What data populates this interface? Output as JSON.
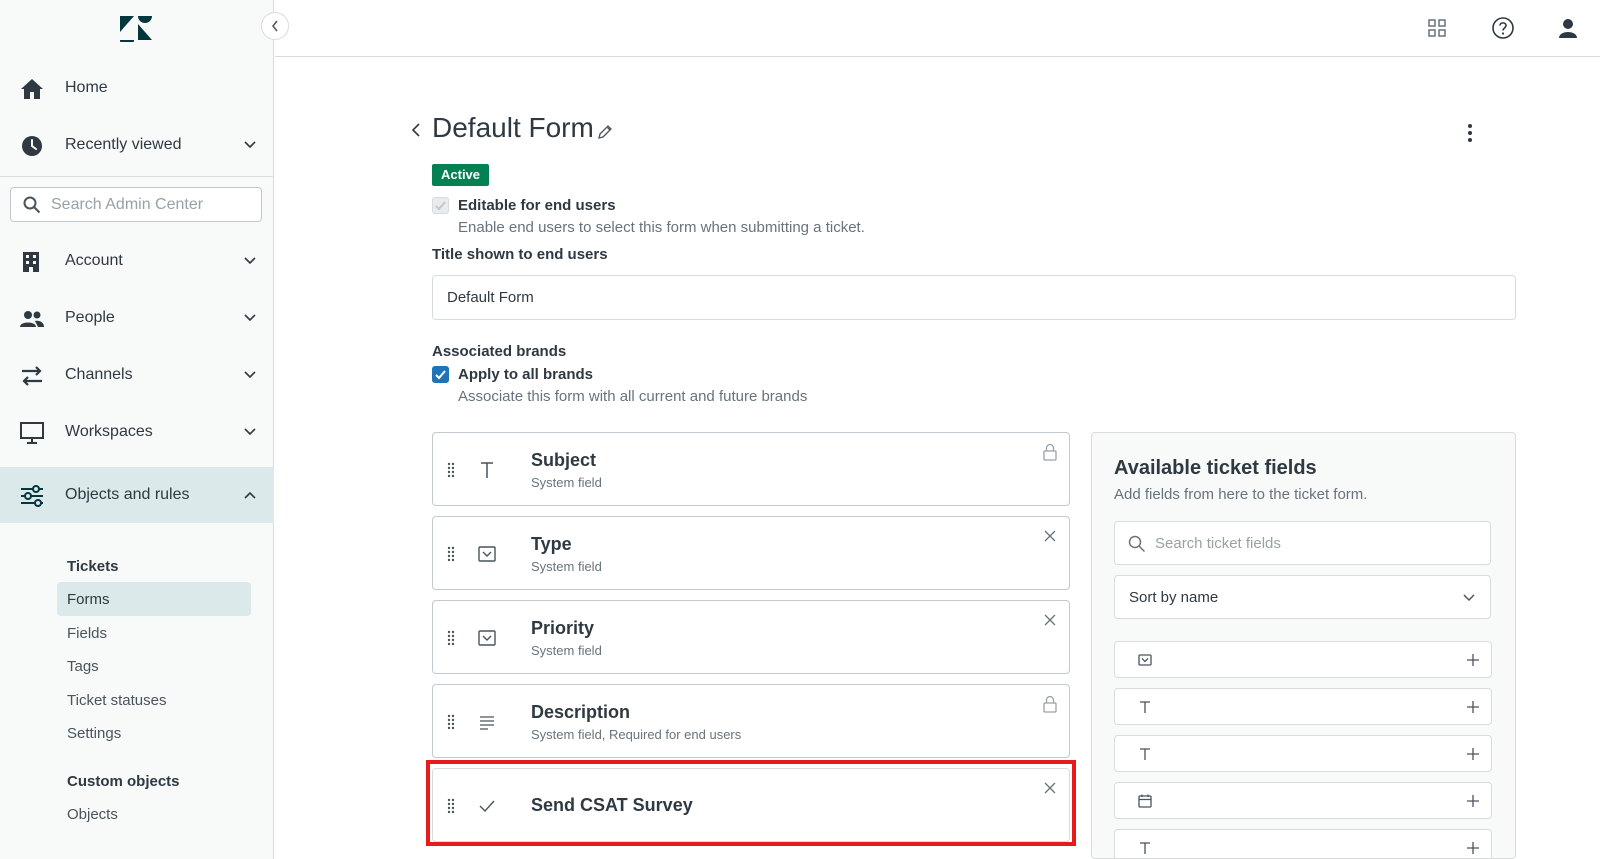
{
  "sidebar": {
    "nav": [
      {
        "label": "Home",
        "icon": "home-icon"
      },
      {
        "label": "Recently viewed",
        "icon": "clock-icon"
      },
      {
        "label": "Account",
        "icon": "building-icon"
      },
      {
        "label": "People",
        "icon": "people-icon"
      },
      {
        "label": "Channels",
        "icon": "channels-icon"
      },
      {
        "label": "Workspaces",
        "icon": "monitor-icon"
      },
      {
        "label": "Objects and rules",
        "icon": "objects-rules-icon"
      }
    ],
    "search_placeholder": "Search Admin Center",
    "tickets_heading": "Tickets",
    "ticket_items": [
      "Forms",
      "Fields",
      "Tags",
      "Ticket statuses",
      "Settings"
    ],
    "custom_objects_heading": "Custom objects",
    "custom_object_items": [
      "Objects"
    ]
  },
  "form": {
    "title": "Default Form",
    "status_badge": "Active",
    "editable_label": "Editable for end users",
    "editable_hint": "Enable end users to select this form when submitting a ticket.",
    "title_label": "Title shown to end users",
    "title_value": "Default Form",
    "brands_label": "Associated brands",
    "brands_checkbox_label": "Apply to all brands",
    "brands_hint": "Associate this form with all current and future brands"
  },
  "fields": [
    {
      "title": "Subject",
      "subtitle": "System field",
      "type_icon": "text-icon",
      "action": "lock-icon"
    },
    {
      "title": "Type",
      "subtitle": "System field",
      "type_icon": "dropdown-icon",
      "action": "close-icon"
    },
    {
      "title": "Priority",
      "subtitle": "System field",
      "type_icon": "dropdown-icon",
      "action": "close-icon"
    },
    {
      "title": "Description",
      "subtitle": "System field, Required for end users",
      "type_icon": "multiline-icon",
      "action": "lock-icon"
    },
    {
      "title": "Send CSAT Survey",
      "subtitle": "",
      "type_icon": "checkbox-icon",
      "action": "close-icon"
    }
  ],
  "available": {
    "title": "Available ticket fields",
    "subtitle": "Add fields from here to the ticket form.",
    "search_placeholder": "Search ticket fields",
    "sort_value": "Sort by name",
    "items": [
      {
        "type_icon": "dropdown-icon"
      },
      {
        "type_icon": "text-icon"
      },
      {
        "type_icon": "text-icon"
      },
      {
        "type_icon": "calendar-icon"
      },
      {
        "type_icon": "text-icon"
      }
    ]
  },
  "colors": {
    "active_badge": "#038153",
    "checkbox_blue": "#1f73b7",
    "nav_active_bg": "#dbe9ea",
    "highlight_red": "#e61c1c"
  }
}
